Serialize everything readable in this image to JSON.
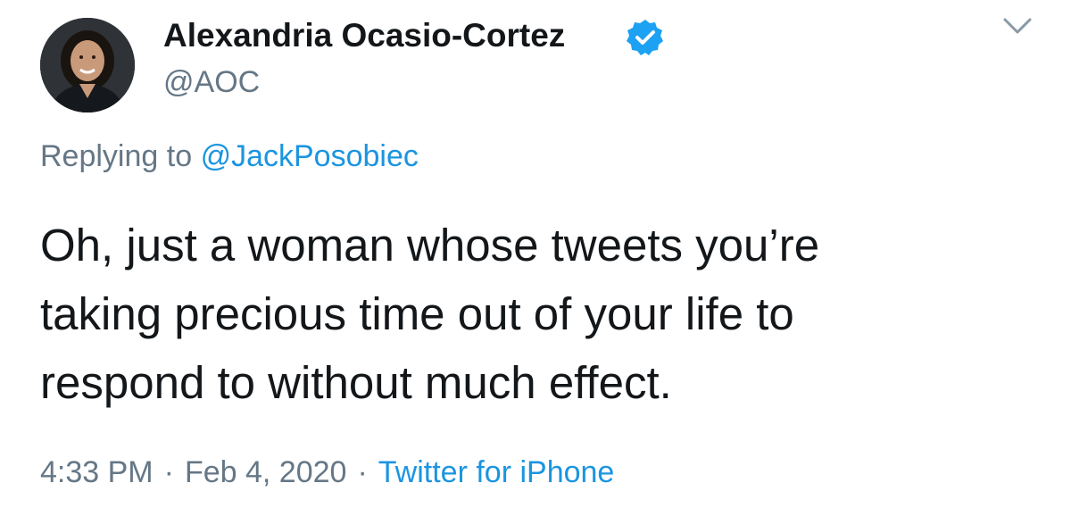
{
  "tweet": {
    "author_name": "Alexandria Ocasio-Cortez",
    "author_handle": "@AOC",
    "verified": true,
    "replying_prefix": "Replying to",
    "replying_to": "@JackPosobiec",
    "text_lines": [
      "Oh, just a woman whose tweets you’re",
      "taking precious time out of your life to",
      "respond to without much effect."
    ],
    "time": "4:33 PM",
    "date": "Feb 4, 2020",
    "separator": "·",
    "source": "Twitter for iPhone"
  },
  "icons": {
    "verified": "verified-badge-icon",
    "menu": "chevron-down-icon"
  },
  "colors": {
    "text": "#14171a",
    "muted": "#657786",
    "link": "#1b95e0",
    "verified": "#1da1f2"
  }
}
